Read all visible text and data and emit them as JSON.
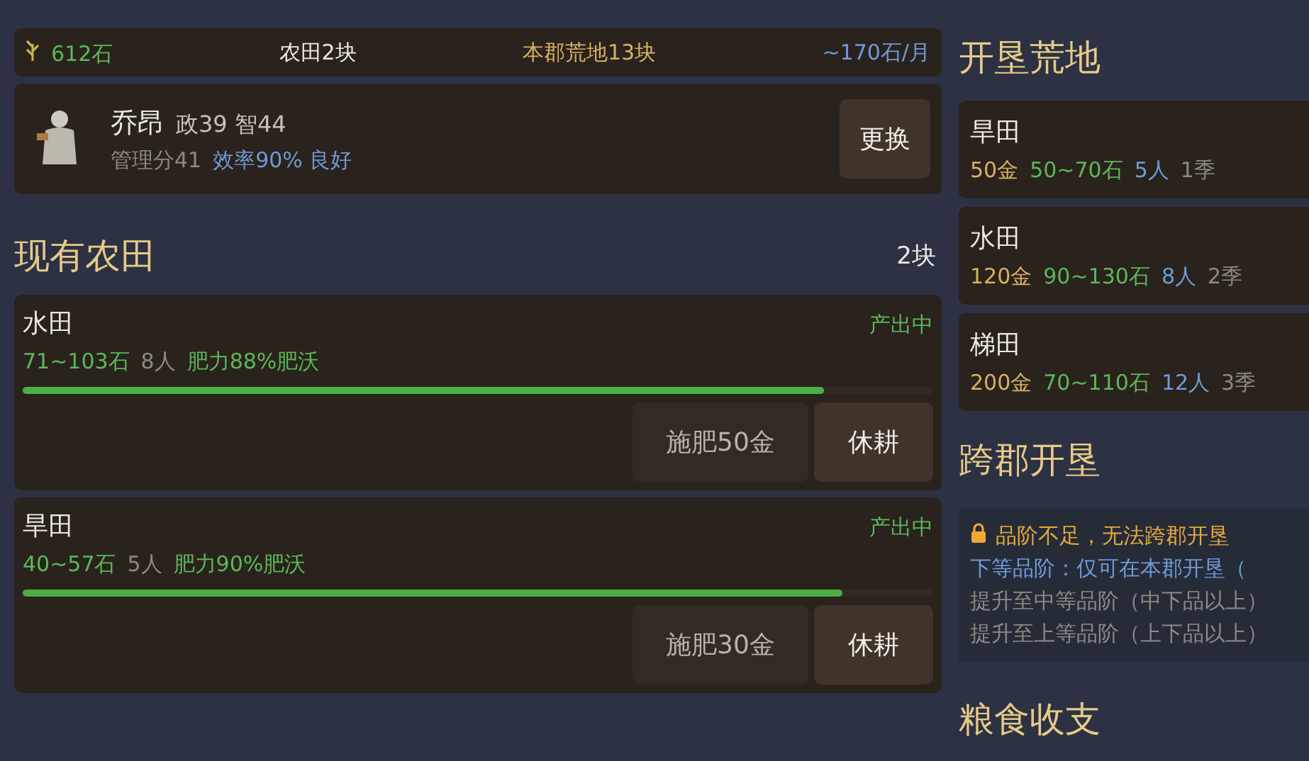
{
  "summary": {
    "grain": "612石",
    "fields": "农田2块",
    "wasteland": "本郡荒地13块",
    "income": "~170石/月"
  },
  "manager": {
    "name": "乔昂",
    "stats": "政39 智44",
    "score": "管理分41",
    "efficiency": "效率90% 良好",
    "button": "更换"
  },
  "farms": {
    "title": "现有农田",
    "count": "2块",
    "items": [
      {
        "name": "水田",
        "status": "产出中",
        "yield": "71~103石",
        "workers": "8人",
        "fertility": "肥力88%肥沃",
        "level": 0.88,
        "fertilize": "施肥50金",
        "fallow": "休耕"
      },
      {
        "name": "旱田",
        "status": "产出中",
        "yield": "40~57石",
        "workers": "5人",
        "fertility": "肥力90%肥沃",
        "level": 0.9,
        "fertilize": "施肥30金",
        "fallow": "休耕"
      }
    ]
  },
  "reclaim": {
    "title": "开垦荒地",
    "items": [
      {
        "name": "旱田",
        "cost": "50金",
        "yield": "50~70石",
        "workers": "5人",
        "time": "1季"
      },
      {
        "name": "水田",
        "cost": "120金",
        "yield": "90~130石",
        "workers": "8人",
        "time": "2季"
      },
      {
        "name": "梯田",
        "cost": "200金",
        "yield": "70~110石",
        "workers": "12人",
        "time": "3季"
      }
    ]
  },
  "cross": {
    "title": "跨郡开垦",
    "locked": true,
    "warning": "品阶不足，无法跨郡开垦",
    "lines": [
      {
        "kind": "current",
        "text": "下等品阶：仅可在本郡开垦（"
      },
      {
        "kind": "next",
        "text": "提升至中等品阶（中下品以上）"
      },
      {
        "kind": "next",
        "text": "提升至上等品阶（上下品以上）"
      }
    ]
  },
  "grain_section": {
    "title": "粮食收支"
  }
}
